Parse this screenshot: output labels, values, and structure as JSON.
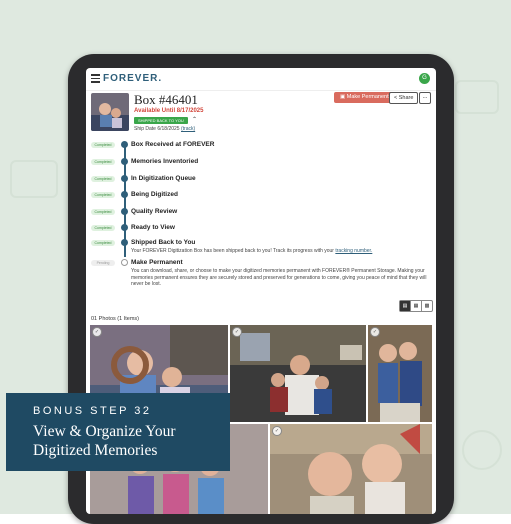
{
  "app": {
    "logo": "FOREVER.",
    "avatar_initial": "G"
  },
  "box": {
    "title": "Box #46401",
    "available": "Available Until 8/17/2025",
    "badge": "SHIPPED BACK TO YOU",
    "ship_date_label": "Ship Date 6/18/2025",
    "track_label": "(track)"
  },
  "actions": {
    "make_permanent": "Make Permanent",
    "share": "Share",
    "more": "..."
  },
  "timeline": [
    {
      "status": "Completed",
      "label": "Box Received at FOREVER"
    },
    {
      "status": "Completed",
      "label": "Memories Inventoried"
    },
    {
      "status": "Completed",
      "label": "In Digitization Queue"
    },
    {
      "status": "Completed",
      "label": "Being Digitized"
    },
    {
      "status": "Completed",
      "label": "Quality Review"
    },
    {
      "status": "Completed",
      "label": "Ready to View"
    },
    {
      "status": "Completed",
      "label": "Shipped Back to You",
      "desc": "Your FOREVER Digitization Box has been shipped back to you! Track its progress with your",
      "link": "tracking number."
    },
    {
      "status": "Pending",
      "label": "Make Permanent",
      "desc": "You can download, share, or choose to make your digitized memories permanent with FOREVER® Permanent Storage. Making your memories permanent ensures they are securely stored and preserved for generations to come, giving you peace of mind that they will never be lost."
    }
  ],
  "photos": {
    "count_label": "01 Photos (1 Items)"
  },
  "view_toggle": [
    "▤",
    "▦",
    "▩"
  ],
  "banner": {
    "subtitle": "BONUS STEP 32",
    "title": "View & Organize Your Digitized Memories"
  },
  "colors": {
    "accent": "#2f5f7a",
    "green": "#3aa64a",
    "red": "#d96b5e",
    "banner": "#1f4a63"
  }
}
